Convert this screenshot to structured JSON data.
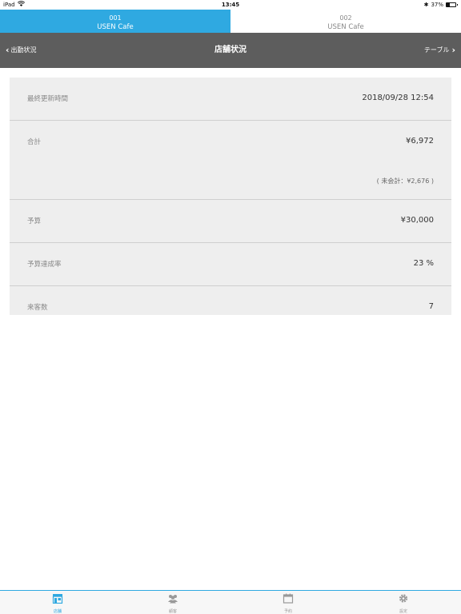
{
  "status_bar": {
    "device": "iPad",
    "time": "13:45",
    "battery": "37%"
  },
  "store_tabs": [
    {
      "number": "001",
      "name": "USEN Cafe",
      "active": true
    },
    {
      "number": "002",
      "name": "USEN Cafe",
      "active": false
    }
  ],
  "navbar": {
    "back_label": "出勤状況",
    "title": "店舗状況",
    "forward_label": "テーブル"
  },
  "stats": {
    "last_update_label": "最終更新時間",
    "last_update_value": "2018/09/28 12:54",
    "total_label": "合計",
    "total_value": "¥6,972",
    "unpaid_note": "( 未会計：¥2,676 )",
    "budget_label": "予算",
    "budget_value": "¥30,000",
    "achievement_label": "予算達成率",
    "achievement_value": "23 %",
    "visitors_label": "来客数",
    "visitors_value": "7"
  },
  "tab_bar": {
    "items": [
      {
        "label": "店舗",
        "icon": "store-icon",
        "active": true
      },
      {
        "label": "顧客",
        "icon": "customers-icon",
        "active": false
      },
      {
        "label": "予約",
        "icon": "calendar-icon",
        "active": false
      },
      {
        "label": "設定",
        "icon": "gear-icon",
        "active": false
      }
    ]
  },
  "colors": {
    "accent": "#2fa9e1",
    "navbar": "#5d5d5d",
    "panel": "#eeeeee"
  }
}
